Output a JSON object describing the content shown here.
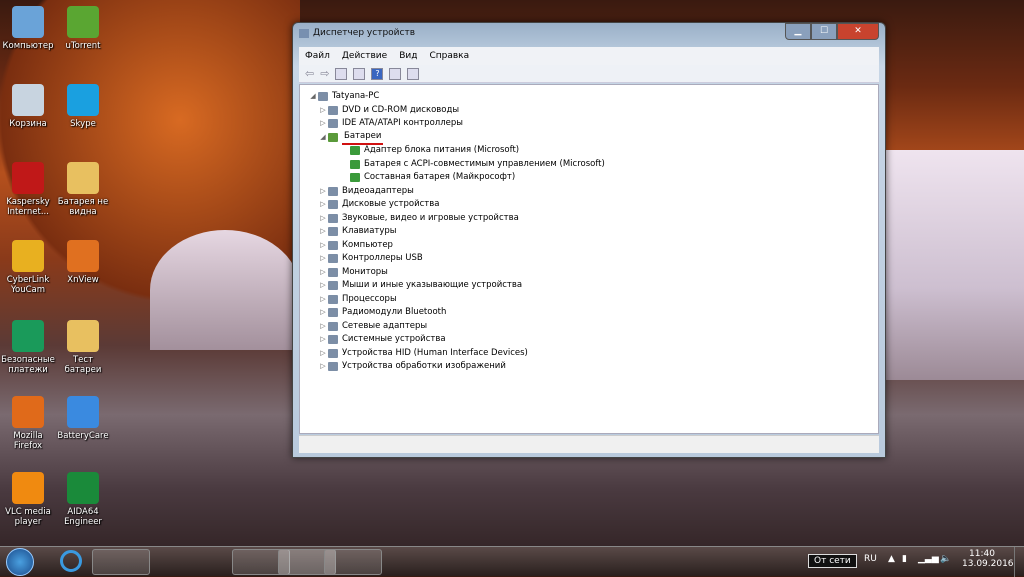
{
  "desktop_icons": [
    {
      "label": "Компьютер",
      "color": "#6aa3d8"
    },
    {
      "label": "uTorrent",
      "color": "#5aa632"
    },
    {
      "label": "Корзина",
      "color": "#c8d4e0"
    },
    {
      "label": "Skype",
      "color": "#1aa0e0"
    },
    {
      "label": "Kaspersky Internet...",
      "color": "#c01818"
    },
    {
      "label": "Батарея не видна",
      "color": "#e8c060"
    },
    {
      "label": "CyberLink YouCam",
      "color": "#e8b020"
    },
    {
      "label": "XnView",
      "color": "#e07020"
    },
    {
      "label": "Безопасные платежи",
      "color": "#1a9a5a"
    },
    {
      "label": "Тест батареи",
      "color": "#e8c060"
    },
    {
      "label": "Mozilla Firefox",
      "color": "#e06a1a"
    },
    {
      "label": "BatteryCare",
      "color": "#3a8ae0"
    },
    {
      "label": "VLC media player",
      "color": "#f08a10"
    },
    {
      "label": "AIDA64 Engineer",
      "color": "#1a8a3a"
    }
  ],
  "window": {
    "title": "Диспетчер устройств",
    "menu": [
      "Файл",
      "Действие",
      "Вид",
      "Справка"
    ],
    "root": "Tatyana-PC",
    "items": [
      {
        "label": "DVD и CD-ROM дисководы",
        "level": 1,
        "expander": "▷"
      },
      {
        "label": "IDE ATA/ATAPI контроллеры",
        "level": 1,
        "expander": "▷"
      },
      {
        "label": "Батареи",
        "level": 1,
        "expander": "◢",
        "highlight": true
      },
      {
        "label": "Адаптер блока питания (Microsoft)",
        "level": 2,
        "expander": ""
      },
      {
        "label": "Батарея с ACPI-совместимым управлением (Microsoft)",
        "level": 2,
        "expander": ""
      },
      {
        "label": "Составная батарея (Майкрософт)",
        "level": 2,
        "expander": ""
      },
      {
        "label": "Видеоадаптеры",
        "level": 1,
        "expander": "▷"
      },
      {
        "label": "Дисковые устройства",
        "level": 1,
        "expander": "▷"
      },
      {
        "label": "Звуковые, видео и игровые устройства",
        "level": 1,
        "expander": "▷"
      },
      {
        "label": "Клавиатуры",
        "level": 1,
        "expander": "▷"
      },
      {
        "label": "Компьютер",
        "level": 1,
        "expander": "▷"
      },
      {
        "label": "Контроллеры USB",
        "level": 1,
        "expander": "▷"
      },
      {
        "label": "Мониторы",
        "level": 1,
        "expander": "▷"
      },
      {
        "label": "Мыши и иные указывающие устройства",
        "level": 1,
        "expander": "▷"
      },
      {
        "label": "Процессоры",
        "level": 1,
        "expander": "▷"
      },
      {
        "label": "Радиомодули Bluetooth",
        "level": 1,
        "expander": "▷"
      },
      {
        "label": "Сетевые адаптеры",
        "level": 1,
        "expander": "▷"
      },
      {
        "label": "Системные устройства",
        "level": 1,
        "expander": "▷"
      },
      {
        "label": "Устройства HID (Human Interface Devices)",
        "level": 1,
        "expander": "▷"
      },
      {
        "label": "Устройства обработки изображений",
        "level": 1,
        "expander": "▷"
      }
    ]
  },
  "taskbar": {
    "power_tooltip": "От сети",
    "lang": "RU",
    "time": "11:40",
    "date": "13.09.2016"
  },
  "accent": "#d01010"
}
